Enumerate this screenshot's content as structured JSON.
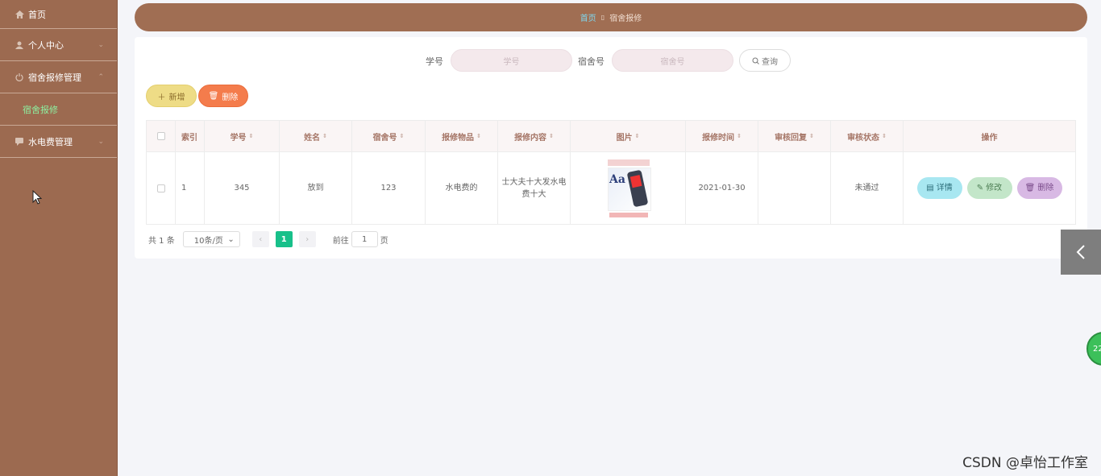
{
  "sidebar": {
    "items": [
      {
        "label": "首页",
        "icon": "home-icon"
      },
      {
        "label": "个人中心",
        "icon": "user-icon"
      },
      {
        "label": "宿舍报修管理",
        "icon": "power-icon"
      },
      {
        "label": "宿舍报修",
        "icon": ""
      },
      {
        "label": "水电费管理",
        "icon": "chat-icon"
      }
    ]
  },
  "breadcrumb": {
    "home": "首页",
    "separator": "▯",
    "current": "宿舍报修"
  },
  "search": {
    "student_id_label": "学号",
    "student_id_placeholder": "学号",
    "dorm_label": "宿舍号",
    "dorm_placeholder": "宿舍号",
    "query_label": "查询"
  },
  "toolbar": {
    "add_label": "新增",
    "delete_label": "删除"
  },
  "table": {
    "headers": [
      "索引",
      "学号",
      "姓名",
      "宿舍号",
      "报修物品",
      "报修内容",
      "图片",
      "报修时间",
      "审核回复",
      "审核状态",
      "操作"
    ],
    "rows": [
      {
        "index": "1",
        "student_id": "345",
        "name": "放到",
        "dorm": "123",
        "item": "水电费的",
        "content": "士大夫十大发水电费十大",
        "image_text": "Aa",
        "time": "2021-01-30",
        "reply": "",
        "status": "未通过",
        "actions": {
          "detail": "详情",
          "edit": "修改",
          "delete": "删除"
        }
      }
    ]
  },
  "pagination": {
    "total": "共 1 条",
    "page_size": "10条/页",
    "current_page": "1",
    "goto_label": "前往",
    "goto_value": "1",
    "page_suffix": "页"
  },
  "floating": {
    "ball_text": "22"
  },
  "watermark": "CSDN @卓怡工作室",
  "colors": {
    "sidebar_bg": "#9c6a50",
    "breadcrumb_bg": "#a06e53",
    "accent_green": "#18c08a",
    "add_btn": "#eedc86",
    "delete_btn": "#f47c4c"
  }
}
